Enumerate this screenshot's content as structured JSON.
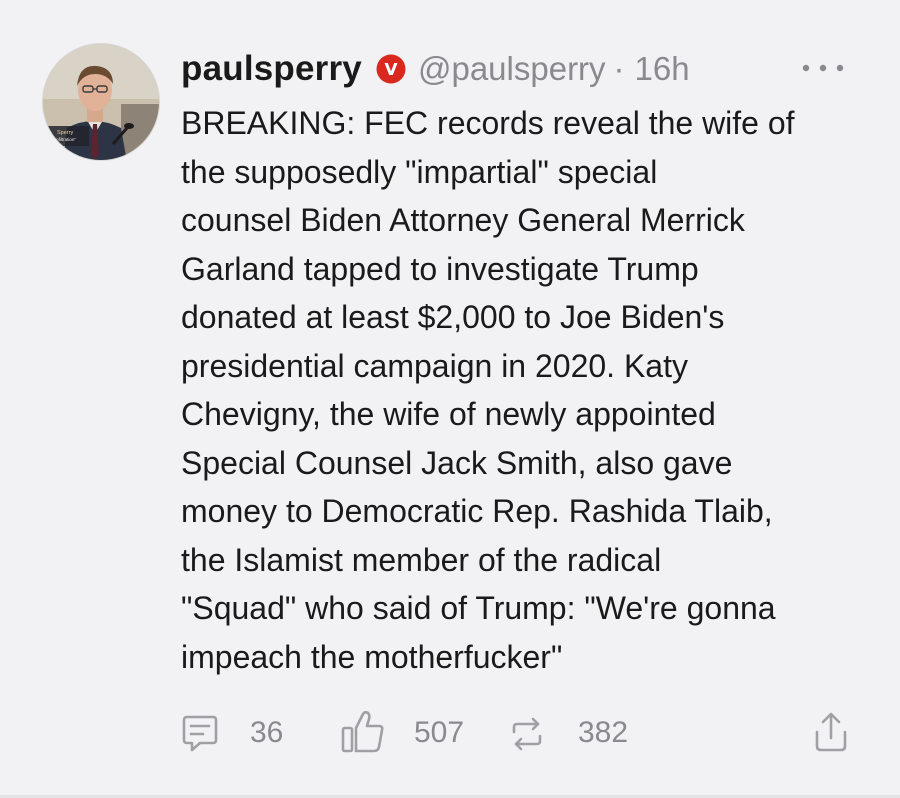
{
  "post": {
    "display_name": "paulsperry",
    "handle": "@paulsperry",
    "separator": "·",
    "time": "16h",
    "body_lines": [
      "BREAKING: FEC records reveal the wife of",
      "the supposedly \"impartial\" special",
      "counsel Biden Attorney General Merrick",
      "Garland tapped to investigate Trump",
      "donated at least $2,000 to Joe Biden's",
      "presidential campaign in 2020. Katy",
      "Chevigny, the wife of newly appointed",
      "Special Counsel Jack Smith, also gave",
      "money to Democratic Rep. Rashida Tlaib,",
      "the Islamist member of the radical",
      "\"Squad\" who said of Trump: \"We're gonna",
      "impeach the motherfucker\""
    ],
    "avatar_caption_lines": [
      "Sperry",
      "or. \"Infiltration\""
    ]
  },
  "actions": {
    "comments": "36",
    "likes": "507",
    "reposts": "382"
  },
  "colors": {
    "background": "#f2f2f4",
    "text": "#1a1a1a",
    "muted": "#8a8a8e",
    "verified_badge": "#d9281e",
    "icon": "#a0a0a4"
  },
  "icons": {
    "verified": "verified-badge-icon",
    "more": "more-dots-icon",
    "comment": "comment-icon",
    "like": "thumbs-up-icon",
    "repost": "repost-icon",
    "share": "share-icon"
  }
}
